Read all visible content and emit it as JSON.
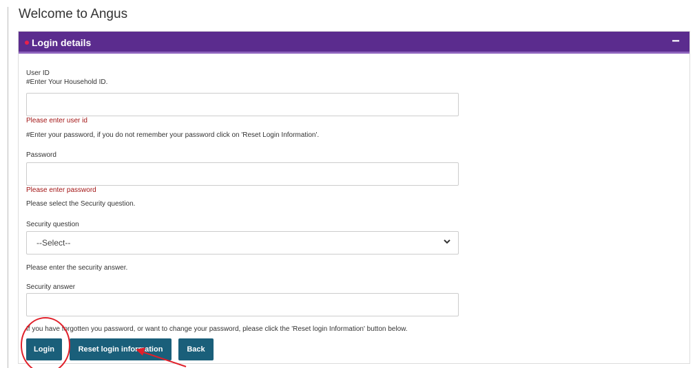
{
  "page": {
    "title": "Welcome to Angus"
  },
  "panel": {
    "title": "Login details",
    "collapse_symbol": "−",
    "header_color": "#5b2c8e",
    "accent_color": "#e8204a"
  },
  "form": {
    "user_id": {
      "label": "User ID",
      "hint": "#Enter Your Household ID.",
      "value": "",
      "error": "Please enter user id"
    },
    "password_hint": "#Enter your password, if you do not remember your password click on 'Reset Login Information'.",
    "password": {
      "label": "Password",
      "value": "",
      "error": "Please enter password"
    },
    "security_question_hint": "Please select the Security question.",
    "security_question": {
      "label": "Security question",
      "selected": "--Select--"
    },
    "security_answer_hint": "Please enter the security answer.",
    "security_answer": {
      "label": "Security answer",
      "value": ""
    },
    "reset_note": "If you have forgotten you password, or want to change your password, please click the 'Reset login Information' button below."
  },
  "buttons": {
    "login": "Login",
    "reset": "Reset login information",
    "back": "Back",
    "color": "#1a5f7a"
  },
  "icons": {
    "select_chevron": "chevron-down-icon",
    "collapse": "minus-icon"
  },
  "annotation_color": "#e0202a",
  "error_color": "#a31515"
}
